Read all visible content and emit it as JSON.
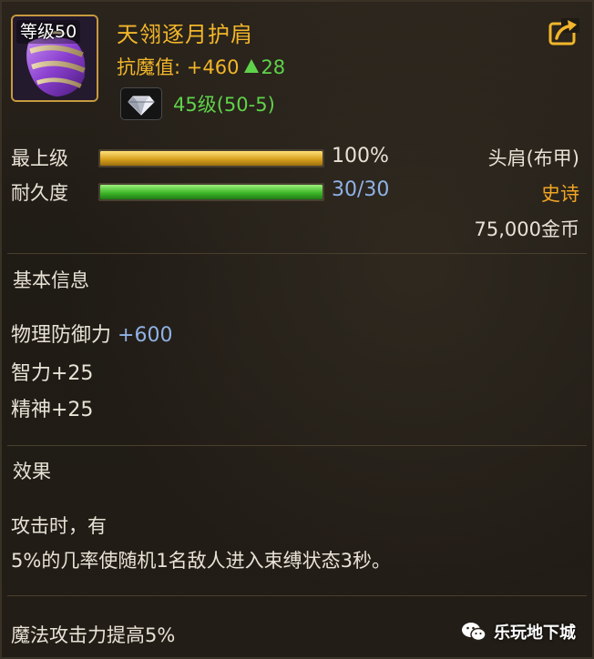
{
  "item": {
    "level_tag": "等级50",
    "name": "天翎逐月护肩",
    "icon": "purple-shoulder-armor-icon"
  },
  "magic_resist": {
    "label": "抗魔值: +460",
    "increase": "28"
  },
  "gem": {
    "icon": "diamond-gem-icon",
    "level_text": "45级(50-5)"
  },
  "bars": {
    "max_level": {
      "label": "最上级",
      "value_text": "100%",
      "fill_fraction": 1.0,
      "color": "#d9a21e"
    },
    "durability": {
      "label": "耐久度",
      "value_text": "30/30",
      "fill_fraction": 1.0,
      "color": "#3fb82a"
    }
  },
  "side_info": {
    "slot": "头肩(布甲)",
    "rarity": "史诗",
    "rarity_color": "#f2a524",
    "price": "75,000金币"
  },
  "basic_info": {
    "title": "基本信息",
    "physical_defense_label": "物理防御力",
    "physical_defense_value": "+600",
    "intelligence": "智力+25",
    "spirit": "精神+25"
  },
  "effect": {
    "title": "效果",
    "line1": "攻击时，有",
    "line2": "5%的几率使随机1名敌人进入束缚状态3秒。",
    "line3": "魔法攻击力提高5%"
  },
  "watermark": {
    "text": "乐玩地下城",
    "icon": "wechat-icon"
  },
  "colors": {
    "title_gold": "#f2b62a",
    "green_text": "#5fd24a",
    "blue_text": "#8fb2e6"
  }
}
